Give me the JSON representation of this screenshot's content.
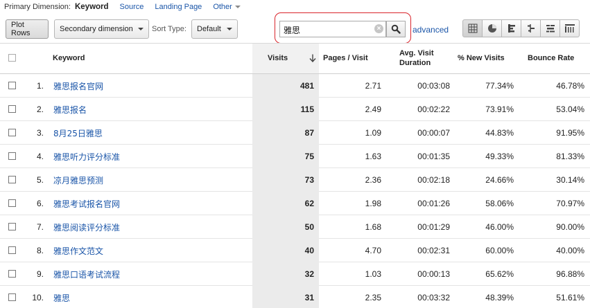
{
  "dimension_bar": {
    "label": "Primary Dimension:",
    "active": "Keyword",
    "links": [
      "Source",
      "Landing Page"
    ],
    "other": "Other"
  },
  "toolbar": {
    "plot_rows": "Plot Rows",
    "secondary_dimension": "Secondary dimension",
    "sort_type_label": "Sort Type:",
    "sort_type_value": "Default",
    "search_value": "雅思",
    "advanced": "advanced",
    "view_icons": [
      "grid-table-icon",
      "pie-chart-icon",
      "performance-bars-icon",
      "comparison-icon",
      "term-cloud-icon",
      "pivot-icon"
    ]
  },
  "table": {
    "headers": {
      "keyword": "Keyword",
      "visits": "Visits",
      "pages_per_visit": "Pages / Visit",
      "avg_visit_duration": "Avg. Visit Duration",
      "new_visits": "% New Visits",
      "bounce_rate": "Bounce Rate"
    },
    "rows": [
      {
        "idx": "1.",
        "keyword": "雅思报名官网",
        "visits": "481",
        "ppv": "2.71",
        "duration": "00:03:08",
        "new": "77.34%",
        "bounce": "46.78%"
      },
      {
        "idx": "2.",
        "keyword": "雅思报名",
        "visits": "115",
        "ppv": "2.49",
        "duration": "00:02:22",
        "new": "73.91%",
        "bounce": "53.04%"
      },
      {
        "idx": "3.",
        "keyword": "8月25日雅思",
        "visits": "87",
        "ppv": "1.09",
        "duration": "00:00:07",
        "new": "44.83%",
        "bounce": "91.95%"
      },
      {
        "idx": "4.",
        "keyword": "雅思听力评分标准",
        "visits": "75",
        "ppv": "1.63",
        "duration": "00:01:35",
        "new": "49.33%",
        "bounce": "81.33%"
      },
      {
        "idx": "5.",
        "keyword": "凉月雅思预测",
        "visits": "73",
        "ppv": "2.36",
        "duration": "00:02:18",
        "new": "24.66%",
        "bounce": "30.14%"
      },
      {
        "idx": "6.",
        "keyword": "雅思考试报名官网",
        "visits": "62",
        "ppv": "1.98",
        "duration": "00:01:26",
        "new": "58.06%",
        "bounce": "70.97%"
      },
      {
        "idx": "7.",
        "keyword": "雅思阅读评分标准",
        "visits": "50",
        "ppv": "1.68",
        "duration": "00:01:29",
        "new": "46.00%",
        "bounce": "90.00%"
      },
      {
        "idx": "8.",
        "keyword": "雅思作文范文",
        "visits": "40",
        "ppv": "4.70",
        "duration": "00:02:31",
        "new": "60.00%",
        "bounce": "40.00%"
      },
      {
        "idx": "9.",
        "keyword": "雅思口语考试流程",
        "visits": "32",
        "ppv": "1.03",
        "duration": "00:00:13",
        "new": "65.62%",
        "bounce": "96.88%"
      },
      {
        "idx": "10.",
        "keyword": "雅思",
        "visits": "31",
        "ppv": "2.35",
        "duration": "00:03:32",
        "new": "48.39%",
        "bounce": "51.61%"
      }
    ]
  }
}
